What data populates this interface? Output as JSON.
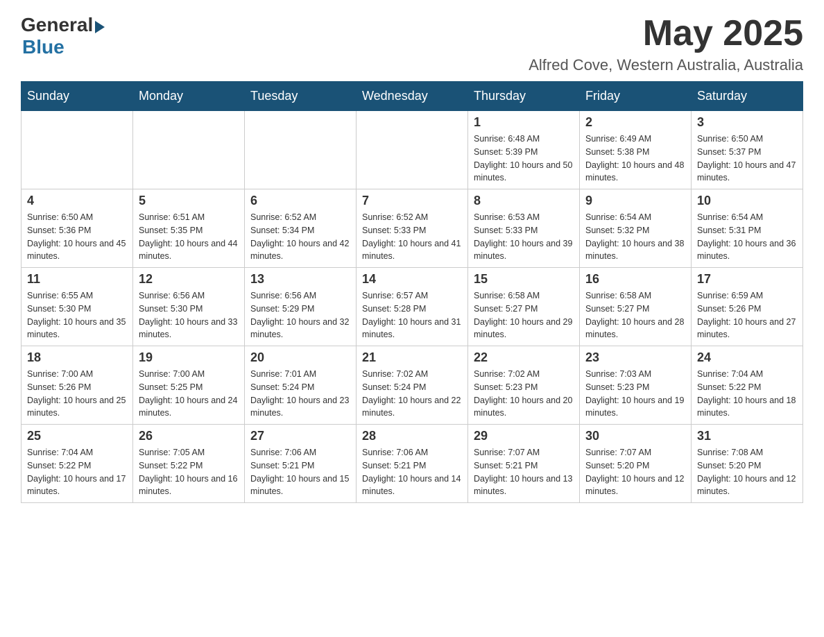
{
  "header": {
    "logo_general": "General",
    "logo_blue": "Blue",
    "month_year": "May 2025",
    "location": "Alfred Cove, Western Australia, Australia"
  },
  "weekdays": [
    "Sunday",
    "Monday",
    "Tuesday",
    "Wednesday",
    "Thursday",
    "Friday",
    "Saturday"
  ],
  "weeks": [
    [
      {
        "day": "",
        "sunrise": "",
        "sunset": "",
        "daylight": ""
      },
      {
        "day": "",
        "sunrise": "",
        "sunset": "",
        "daylight": ""
      },
      {
        "day": "",
        "sunrise": "",
        "sunset": "",
        "daylight": ""
      },
      {
        "day": "",
        "sunrise": "",
        "sunset": "",
        "daylight": ""
      },
      {
        "day": "1",
        "sunrise": "Sunrise: 6:48 AM",
        "sunset": "Sunset: 5:39 PM",
        "daylight": "Daylight: 10 hours and 50 minutes."
      },
      {
        "day": "2",
        "sunrise": "Sunrise: 6:49 AM",
        "sunset": "Sunset: 5:38 PM",
        "daylight": "Daylight: 10 hours and 48 minutes."
      },
      {
        "day": "3",
        "sunrise": "Sunrise: 6:50 AM",
        "sunset": "Sunset: 5:37 PM",
        "daylight": "Daylight: 10 hours and 47 minutes."
      }
    ],
    [
      {
        "day": "4",
        "sunrise": "Sunrise: 6:50 AM",
        "sunset": "Sunset: 5:36 PM",
        "daylight": "Daylight: 10 hours and 45 minutes."
      },
      {
        "day": "5",
        "sunrise": "Sunrise: 6:51 AM",
        "sunset": "Sunset: 5:35 PM",
        "daylight": "Daylight: 10 hours and 44 minutes."
      },
      {
        "day": "6",
        "sunrise": "Sunrise: 6:52 AM",
        "sunset": "Sunset: 5:34 PM",
        "daylight": "Daylight: 10 hours and 42 minutes."
      },
      {
        "day": "7",
        "sunrise": "Sunrise: 6:52 AM",
        "sunset": "Sunset: 5:33 PM",
        "daylight": "Daylight: 10 hours and 41 minutes."
      },
      {
        "day": "8",
        "sunrise": "Sunrise: 6:53 AM",
        "sunset": "Sunset: 5:33 PM",
        "daylight": "Daylight: 10 hours and 39 minutes."
      },
      {
        "day": "9",
        "sunrise": "Sunrise: 6:54 AM",
        "sunset": "Sunset: 5:32 PM",
        "daylight": "Daylight: 10 hours and 38 minutes."
      },
      {
        "day": "10",
        "sunrise": "Sunrise: 6:54 AM",
        "sunset": "Sunset: 5:31 PM",
        "daylight": "Daylight: 10 hours and 36 minutes."
      }
    ],
    [
      {
        "day": "11",
        "sunrise": "Sunrise: 6:55 AM",
        "sunset": "Sunset: 5:30 PM",
        "daylight": "Daylight: 10 hours and 35 minutes."
      },
      {
        "day": "12",
        "sunrise": "Sunrise: 6:56 AM",
        "sunset": "Sunset: 5:30 PM",
        "daylight": "Daylight: 10 hours and 33 minutes."
      },
      {
        "day": "13",
        "sunrise": "Sunrise: 6:56 AM",
        "sunset": "Sunset: 5:29 PM",
        "daylight": "Daylight: 10 hours and 32 minutes."
      },
      {
        "day": "14",
        "sunrise": "Sunrise: 6:57 AM",
        "sunset": "Sunset: 5:28 PM",
        "daylight": "Daylight: 10 hours and 31 minutes."
      },
      {
        "day": "15",
        "sunrise": "Sunrise: 6:58 AM",
        "sunset": "Sunset: 5:27 PM",
        "daylight": "Daylight: 10 hours and 29 minutes."
      },
      {
        "day": "16",
        "sunrise": "Sunrise: 6:58 AM",
        "sunset": "Sunset: 5:27 PM",
        "daylight": "Daylight: 10 hours and 28 minutes."
      },
      {
        "day": "17",
        "sunrise": "Sunrise: 6:59 AM",
        "sunset": "Sunset: 5:26 PM",
        "daylight": "Daylight: 10 hours and 27 minutes."
      }
    ],
    [
      {
        "day": "18",
        "sunrise": "Sunrise: 7:00 AM",
        "sunset": "Sunset: 5:26 PM",
        "daylight": "Daylight: 10 hours and 25 minutes."
      },
      {
        "day": "19",
        "sunrise": "Sunrise: 7:00 AM",
        "sunset": "Sunset: 5:25 PM",
        "daylight": "Daylight: 10 hours and 24 minutes."
      },
      {
        "day": "20",
        "sunrise": "Sunrise: 7:01 AM",
        "sunset": "Sunset: 5:24 PM",
        "daylight": "Daylight: 10 hours and 23 minutes."
      },
      {
        "day": "21",
        "sunrise": "Sunrise: 7:02 AM",
        "sunset": "Sunset: 5:24 PM",
        "daylight": "Daylight: 10 hours and 22 minutes."
      },
      {
        "day": "22",
        "sunrise": "Sunrise: 7:02 AM",
        "sunset": "Sunset: 5:23 PM",
        "daylight": "Daylight: 10 hours and 20 minutes."
      },
      {
        "day": "23",
        "sunrise": "Sunrise: 7:03 AM",
        "sunset": "Sunset: 5:23 PM",
        "daylight": "Daylight: 10 hours and 19 minutes."
      },
      {
        "day": "24",
        "sunrise": "Sunrise: 7:04 AM",
        "sunset": "Sunset: 5:22 PM",
        "daylight": "Daylight: 10 hours and 18 minutes."
      }
    ],
    [
      {
        "day": "25",
        "sunrise": "Sunrise: 7:04 AM",
        "sunset": "Sunset: 5:22 PM",
        "daylight": "Daylight: 10 hours and 17 minutes."
      },
      {
        "day": "26",
        "sunrise": "Sunrise: 7:05 AM",
        "sunset": "Sunset: 5:22 PM",
        "daylight": "Daylight: 10 hours and 16 minutes."
      },
      {
        "day": "27",
        "sunrise": "Sunrise: 7:06 AM",
        "sunset": "Sunset: 5:21 PM",
        "daylight": "Daylight: 10 hours and 15 minutes."
      },
      {
        "day": "28",
        "sunrise": "Sunrise: 7:06 AM",
        "sunset": "Sunset: 5:21 PM",
        "daylight": "Daylight: 10 hours and 14 minutes."
      },
      {
        "day": "29",
        "sunrise": "Sunrise: 7:07 AM",
        "sunset": "Sunset: 5:21 PM",
        "daylight": "Daylight: 10 hours and 13 minutes."
      },
      {
        "day": "30",
        "sunrise": "Sunrise: 7:07 AM",
        "sunset": "Sunset: 5:20 PM",
        "daylight": "Daylight: 10 hours and 12 minutes."
      },
      {
        "day": "31",
        "sunrise": "Sunrise: 7:08 AM",
        "sunset": "Sunset: 5:20 PM",
        "daylight": "Daylight: 10 hours and 12 minutes."
      }
    ]
  ]
}
